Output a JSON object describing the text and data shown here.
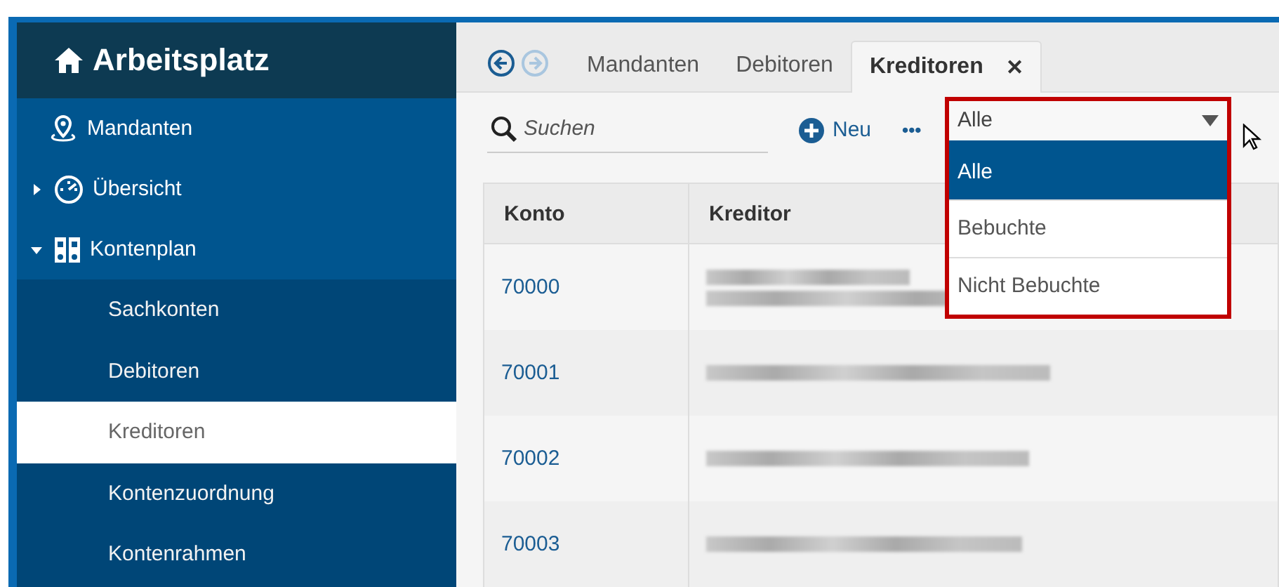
{
  "sidebar": {
    "title": "Arbeitsplatz",
    "items": [
      {
        "label": "Mandanten",
        "selected": false
      },
      {
        "label": "Übersicht",
        "expanded": false,
        "selected": false
      },
      {
        "label": "Kontenplan",
        "expanded": true,
        "selected": false,
        "children": [
          {
            "label": "Sachkonten",
            "selected": false
          },
          {
            "label": "Debitoren",
            "selected": false
          },
          {
            "label": "Kreditoren",
            "selected": true
          },
          {
            "label": "Kontenzuordnung",
            "selected": false
          },
          {
            "label": "Kontenrahmen",
            "selected": false
          }
        ]
      }
    ]
  },
  "tabs": [
    {
      "label": "Mandanten",
      "selected": false,
      "closable": false
    },
    {
      "label": "Debitoren",
      "selected": false,
      "closable": false
    },
    {
      "label": "Kreditoren",
      "selected": true,
      "closable": true,
      "close": "✕"
    }
  ],
  "nav": {
    "back_disabled": false,
    "forward_disabled": true
  },
  "toolbar": {
    "search": {
      "placeholder": "Suchen"
    },
    "new_button": "Neu",
    "more": "•••",
    "filter": {
      "value": "Alle",
      "options": [
        {
          "label": "Alle",
          "selected": true
        },
        {
          "label": "Bebuchte",
          "selected": false
        },
        {
          "label": "Nicht Bebuchte",
          "selected": false
        }
      ]
    }
  },
  "table": {
    "columns": [
      "Konto",
      "Kreditor"
    ],
    "rows": [
      {
        "konto": "70000",
        "kreditor": [
          {
            "kind": "blurred"
          },
          {
            "kind": "blurred"
          }
        ]
      },
      {
        "konto": "70001",
        "kreditor": [
          {
            "kind": "blurred"
          }
        ]
      },
      {
        "konto": "70002",
        "kreditor": [
          {
            "kind": "blurred"
          }
        ]
      },
      {
        "konto": "70003",
        "kreditor": [
          {
            "kind": "blurred"
          }
        ]
      }
    ]
  }
}
